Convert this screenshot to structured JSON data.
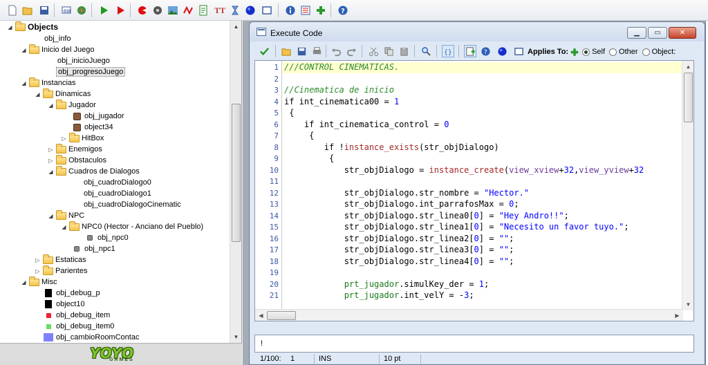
{
  "tree": {
    "root_label": "Objects",
    "nodes": [
      {
        "label": "obj_info"
      },
      {
        "label": "Inicio del Juego"
      },
      {
        "label": "obj_inicioJuego"
      },
      {
        "label": "obj_progresoJuego"
      },
      {
        "label": "Instancias"
      },
      {
        "label": "Dinamicas"
      },
      {
        "label": "Jugador"
      },
      {
        "label": "obj_jugador"
      },
      {
        "label": "object34"
      },
      {
        "label": "HitBox"
      },
      {
        "label": "Enemigos"
      },
      {
        "label": "Obstaculos"
      },
      {
        "label": "Cuadros de Dialogos"
      },
      {
        "label": "obj_cuadroDialogo0"
      },
      {
        "label": "obj_cuadroDialogo1"
      },
      {
        "label": "obj_cuadroDialogoCinematic"
      },
      {
        "label": "NPC"
      },
      {
        "label": "NPC0 (Hector - Anciano del Pueblo)"
      },
      {
        "label": "obj_npc0"
      },
      {
        "label": "obj_npc1"
      },
      {
        "label": "Estaticas"
      },
      {
        "label": "Parientes"
      },
      {
        "label": "Misc"
      },
      {
        "label": "obj_debug_p"
      },
      {
        "label": "object10"
      },
      {
        "label": "obj_debug_item"
      },
      {
        "label": "obj_debug_item0"
      },
      {
        "label": "obj_cambioRoomContac"
      }
    ],
    "selected": "obj_progresoJuego"
  },
  "logo": {
    "brand": "YOYO",
    "sub": "GAMES"
  },
  "window": {
    "title": "Execute Code"
  },
  "editor_toolbar": {
    "applies_label": "Applies To:",
    "options": [
      "Self",
      "Other",
      "Object:"
    ],
    "selected": "Self"
  },
  "code": {
    "lines": [
      {
        "n": "1",
        "text": "///CONTROL CINEMATICAS."
      },
      {
        "n": "2",
        "text": ""
      },
      {
        "n": "3",
        "text": "//Cinematica de inicio"
      },
      {
        "n": "4",
        "text": "if int_cinematica00 = 1"
      },
      {
        "n": "5",
        "text": " {"
      },
      {
        "n": "6",
        "text": "    if int_cinematica_control = 0"
      },
      {
        "n": "7",
        "text": "     {"
      },
      {
        "n": "8",
        "text": "        if !instance_exists(str_objDialogo)"
      },
      {
        "n": "9",
        "text": "         {"
      },
      {
        "n": "10",
        "text": "            str_objDialogo = instance_create(view_xview+32,view_yview+32"
      },
      {
        "n": "11",
        "text": ""
      },
      {
        "n": "12",
        "text": "            str_objDialogo.str_nombre = \"Hector.\""
      },
      {
        "n": "13",
        "text": "            str_objDialogo.int_parrafosMax = 0;"
      },
      {
        "n": "14",
        "text": "            str_objDialogo.str_linea0[0] = \"Hey Andro!!\";"
      },
      {
        "n": "15",
        "text": "            str_objDialogo.str_linea1[0] = \"Necesito un favor tuyo.\";"
      },
      {
        "n": "16",
        "text": "            str_objDialogo.str_linea2[0] = \"\";"
      },
      {
        "n": "17",
        "text": "            str_objDialogo.str_linea3[0] = \"\";"
      },
      {
        "n": "18",
        "text": "            str_objDialogo.str_linea4[0] = \"\";"
      },
      {
        "n": "19",
        "text": ""
      },
      {
        "n": "20",
        "text": "            prt_jugador.simulKey_der = 1;"
      },
      {
        "n": "21",
        "text": "            prt_jugador.int_velY = -3;"
      }
    ]
  },
  "message": "!",
  "status": {
    "position": "1/100:",
    "column": "1",
    "mode": "INS",
    "font_size": "10 pt"
  },
  "colors": {
    "comment": "#2c8a2c",
    "number": "#0000ff",
    "function": "#a52828",
    "current_line": "#ffffd0"
  }
}
